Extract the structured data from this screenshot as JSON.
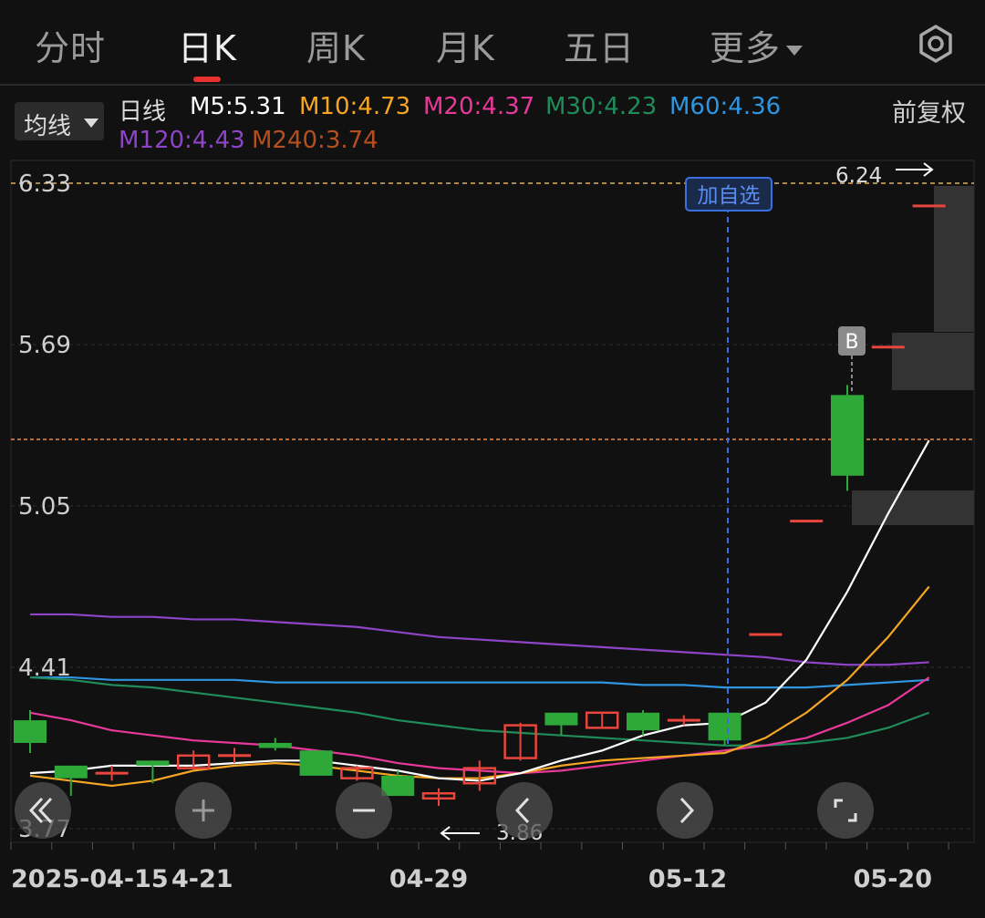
{
  "tabs": [
    {
      "label": "分时"
    },
    {
      "label": "日K",
      "active": true
    },
    {
      "label": "周K"
    },
    {
      "label": "月K"
    },
    {
      "label": "五日"
    },
    {
      "label": "更多"
    }
  ],
  "icons": {
    "settings": "gear-icon",
    "more": "caret-down-icon",
    "ma_select": "caret-down-icon"
  },
  "ma_bar": {
    "select_label": "均线",
    "period": "日线",
    "adjust": "前复权",
    "m5": "M5:5.31",
    "m10": "M10:4.73",
    "m20": "M20:4.37",
    "m30": "M30:4.23",
    "m60": "M60:4.36",
    "m120": "M120:4.43",
    "m240": "M240:3.74"
  },
  "colors": {
    "bg": "#111111",
    "up": "#e8453c",
    "down": "#2fa83a",
    "m5": "#ffffff",
    "m10": "#f5a623",
    "m20": "#e8399a",
    "m30": "#1f8c5a",
    "m60": "#2f95e0",
    "m120": "#8e44c7",
    "m240": "#b5501e",
    "accent": "#e8312f"
  },
  "annotations": {
    "add_watchlist": "加自选",
    "buy_marker": "B",
    "max_label": "6.24",
    "min_label": "3.86"
  },
  "chart_data": {
    "type": "candlestick",
    "y_ticks": [
      "6.33",
      "5.69",
      "5.05",
      "4.41",
      "3.77"
    ],
    "ylim": [
      3.77,
      6.33
    ],
    "x_labels": [
      "2025-04-15",
      "4-21",
      "04-29",
      "05-12",
      "05-20"
    ],
    "max_price": 6.24,
    "min_price": 3.86,
    "candles": [
      {
        "o": 4.2,
        "c": 4.11,
        "h": 4.24,
        "l": 4.07
      },
      {
        "o": 4.02,
        "c": 3.97,
        "h": 4.02,
        "l": 3.9
      },
      {
        "o": 3.99,
        "c": 3.99,
        "h": 4.02,
        "l": 3.96
      },
      {
        "o": 4.04,
        "c": 4.02,
        "h": 4.04,
        "l": 3.95
      },
      {
        "o": 4.01,
        "c": 4.06,
        "h": 4.08,
        "l": 4.01
      },
      {
        "o": 4.06,
        "c": 4.06,
        "h": 4.09,
        "l": 4.03
      },
      {
        "o": 4.11,
        "c": 4.09,
        "h": 4.13,
        "l": 4.08
      },
      {
        "o": 4.08,
        "c": 3.98,
        "h": 4.08,
        "l": 3.98
      },
      {
        "o": 3.97,
        "c": 4.01,
        "h": 4.02,
        "l": 3.96
      },
      {
        "o": 3.98,
        "c": 3.9,
        "h": 4.0,
        "l": 3.9
      },
      {
        "o": 3.89,
        "c": 3.91,
        "h": 3.93,
        "l": 3.86
      },
      {
        "o": 3.95,
        "c": 4.01,
        "h": 4.04,
        "l": 3.92
      },
      {
        "o": 4.05,
        "c": 4.18,
        "h": 4.19,
        "l": 4.04
      },
      {
        "o": 4.23,
        "c": 4.18,
        "h": 4.23,
        "l": 4.14
      },
      {
        "o": 4.17,
        "c": 4.23,
        "h": 4.23,
        "l": 4.17
      },
      {
        "o": 4.23,
        "c": 4.16,
        "h": 4.24,
        "l": 4.14
      },
      {
        "o": 4.2,
        "c": 4.2,
        "h": 4.22,
        "l": 4.18
      },
      {
        "o": 4.23,
        "c": 4.12,
        "h": 4.23,
        "l": 4.1
      },
      {
        "o": 4.54,
        "c": 4.54,
        "h": 4.54,
        "l": 4.54
      },
      {
        "o": 4.99,
        "c": 4.99,
        "h": 4.99,
        "l": 4.99
      },
      {
        "o": 5.49,
        "c": 5.17,
        "h": 5.53,
        "l": 5.11
      },
      {
        "o": 5.68,
        "c": 5.68,
        "h": 5.68,
        "l": 5.68
      },
      {
        "o": 6.24,
        "c": 6.24,
        "h": 6.24,
        "l": 6.24
      }
    ],
    "ma": {
      "m5": [
        3.99,
        4.0,
        4.02,
        4.02,
        4.02,
        4.03,
        4.04,
        4.04,
        4.02,
        4.0,
        3.97,
        3.96,
        3.99,
        4.04,
        4.08,
        4.14,
        4.18,
        4.19,
        4.27,
        4.44,
        4.71,
        5.02,
        5.31
      ],
      "m10": [
        3.98,
        3.96,
        3.94,
        3.96,
        4.0,
        4.02,
        4.03,
        4.02,
        4.0,
        3.98,
        3.97,
        3.97,
        3.99,
        4.02,
        4.04,
        4.05,
        4.06,
        4.07,
        4.13,
        4.23,
        4.36,
        4.53,
        4.73
      ],
      "m20": [
        4.23,
        4.2,
        4.16,
        4.14,
        4.12,
        4.11,
        4.1,
        4.08,
        4.06,
        4.03,
        4.01,
        4.0,
        3.99,
        4.0,
        4.02,
        4.04,
        4.06,
        4.08,
        4.1,
        4.13,
        4.19,
        4.26,
        4.37
      ],
      "m30": [
        4.37,
        4.36,
        4.34,
        4.33,
        4.31,
        4.29,
        4.27,
        4.25,
        4.23,
        4.2,
        4.18,
        4.16,
        4.15,
        4.14,
        4.13,
        4.12,
        4.11,
        4.1,
        4.1,
        4.11,
        4.13,
        4.17,
        4.23
      ],
      "m60": [
        4.37,
        4.37,
        4.36,
        4.36,
        4.36,
        4.36,
        4.35,
        4.35,
        4.35,
        4.35,
        4.35,
        4.35,
        4.35,
        4.35,
        4.35,
        4.34,
        4.34,
        4.33,
        4.33,
        4.33,
        4.34,
        4.35,
        4.36
      ],
      "m120": [
        4.62,
        4.62,
        4.61,
        4.61,
        4.6,
        4.6,
        4.59,
        4.58,
        4.57,
        4.55,
        4.53,
        4.52,
        4.51,
        4.5,
        4.49,
        4.48,
        4.47,
        4.46,
        4.45,
        4.43,
        4.42,
        4.42,
        4.43
      ]
    }
  }
}
